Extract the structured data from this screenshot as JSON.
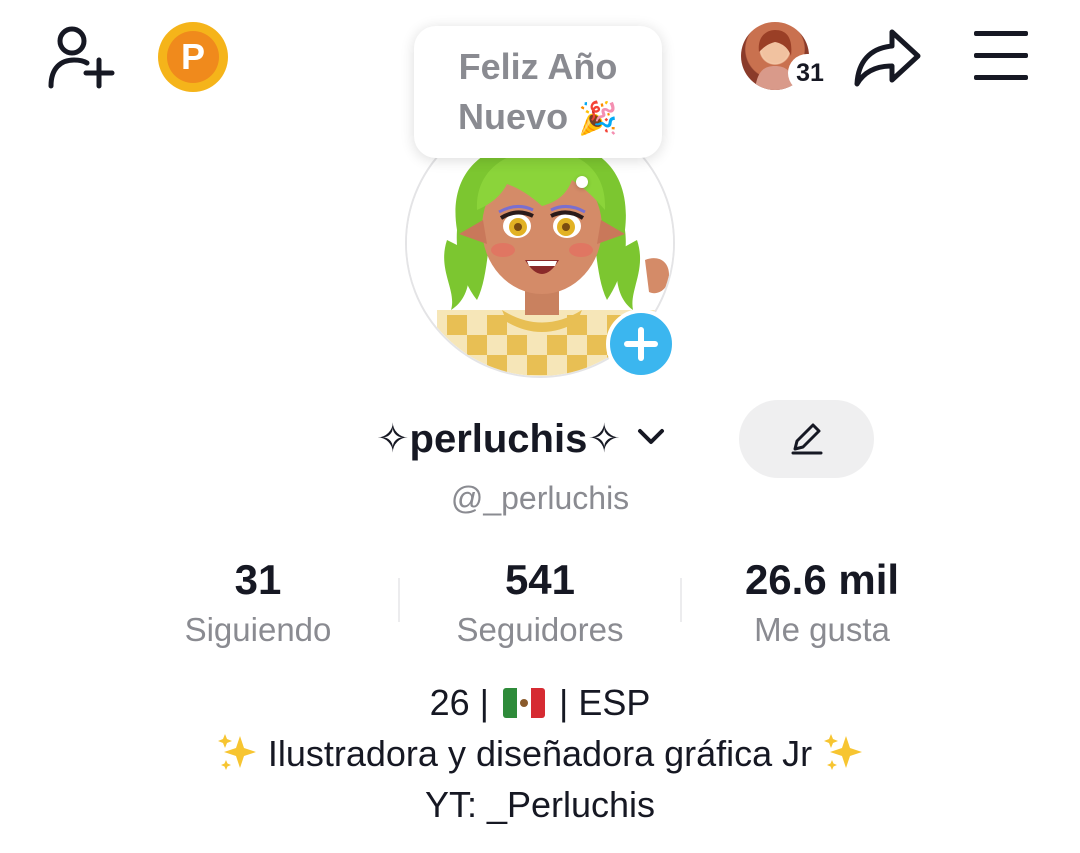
{
  "topbar": {
    "add_friend_icon": "person-plus-icon",
    "coin_label": "P",
    "friends_count": "31",
    "share_icon": "share-arrow-icon",
    "menu_icon": "hamburger-menu-icon"
  },
  "bubble": {
    "line1": "Feliz Año",
    "line2": "Nuevo",
    "emoji": "🎉"
  },
  "profile": {
    "name": "✧perluchis✧",
    "handle": "@_perluchis"
  },
  "stats": [
    {
      "value": "31",
      "label": "Siguiendo"
    },
    {
      "value": "541",
      "label": "Seguidores"
    },
    {
      "value": "26.6 mil",
      "label": "Me gusta"
    }
  ],
  "bio": {
    "line1_left": "26 |",
    "line1_right": "| ESP",
    "flag": "mexico-flag",
    "line2": "Ilustradora y diseñadora gráfica Jr",
    "line3": "YT: _Perluchis"
  },
  "colors": {
    "accent_blue": "#3bb6ef",
    "coin_orange": "#f08a1c",
    "muted_text": "#8a8b91",
    "text": "#161823"
  }
}
